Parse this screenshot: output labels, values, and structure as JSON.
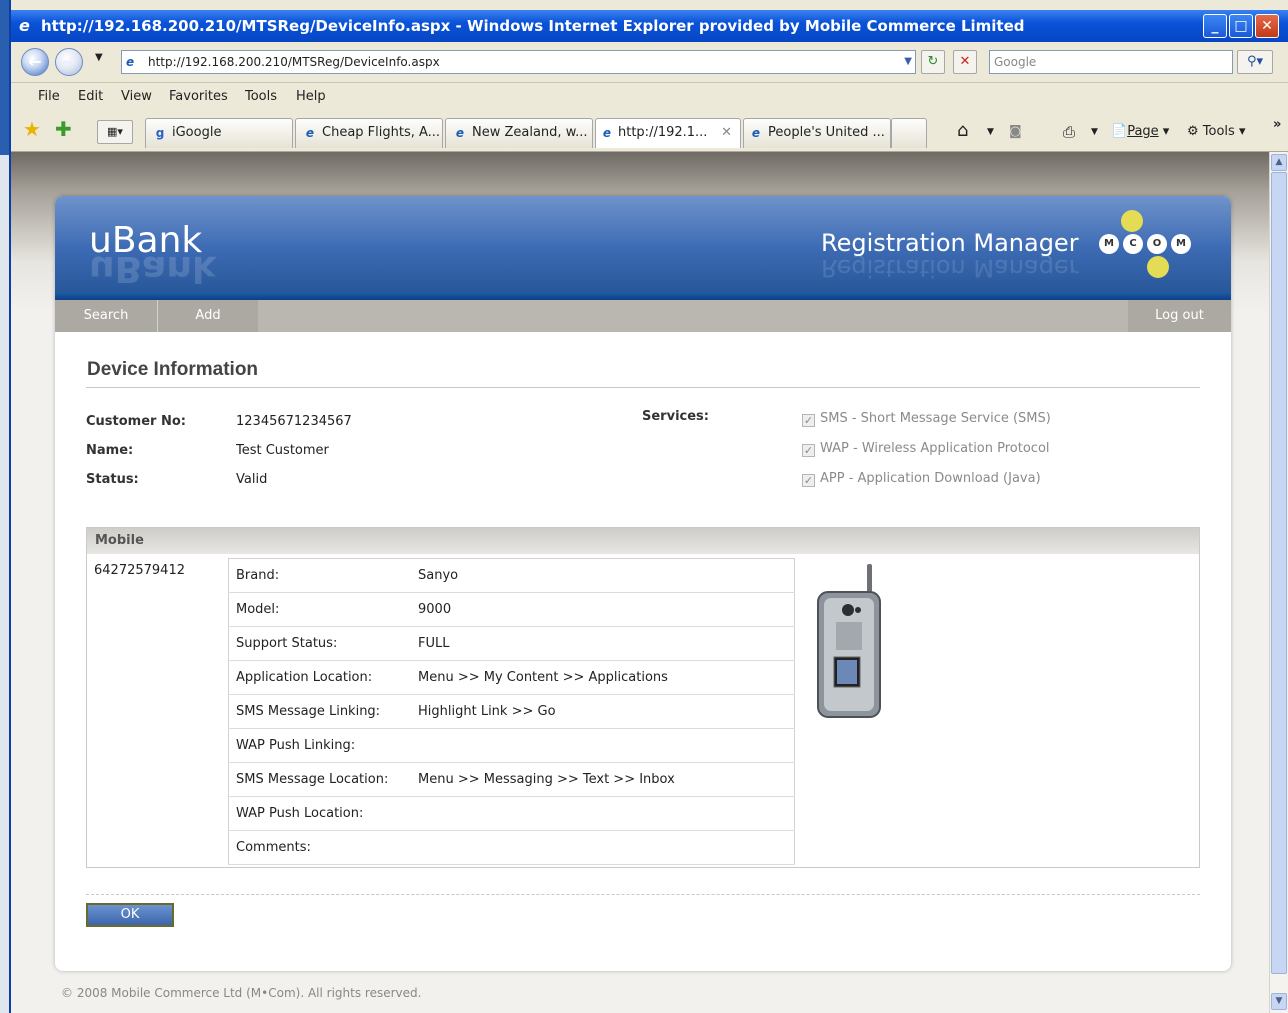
{
  "window": {
    "title": "http://192.168.200.210/MTSReg/DeviceInfo.aspx - Windows Internet Explorer provided by Mobile Commerce Limited",
    "url": "http://192.168.200.210/MTSReg/DeviceInfo.aspx",
    "search_placeholder": "Google"
  },
  "menu": [
    "File",
    "Edit",
    "View",
    "Favorites",
    "Tools",
    "Help"
  ],
  "tabs": [
    {
      "label": "iGoogle",
      "icon": "google-icon"
    },
    {
      "label": "Cheap Flights, A...",
      "icon": "ie-page-icon"
    },
    {
      "label": "New Zealand, w...",
      "icon": "ie-page-icon"
    },
    {
      "label": "http://192.1...",
      "icon": "ie-page-icon",
      "active": true
    },
    {
      "label": "People's United ...",
      "icon": "ie-page-icon"
    }
  ],
  "command_bar": {
    "page_label": "Page",
    "tools_label": "Tools"
  },
  "app": {
    "logo": "uBank",
    "product": "Registration Manager",
    "brand_letters": [
      "M",
      "C",
      "O",
      "M"
    ],
    "nav": {
      "search": "Search",
      "add": "Add",
      "logout": "Log out"
    }
  },
  "device_info": {
    "heading": "Device Information",
    "customer_no_label": "Customer No:",
    "customer_no": "12345671234567",
    "name_label": "Name:",
    "name": "Test Customer",
    "status_label": "Status:",
    "status": "Valid",
    "services_label": "Services:",
    "services": [
      {
        "label": "SMS - Short Message Service (SMS)",
        "checked": true
      },
      {
        "label": "WAP - Wireless Application Protocol",
        "checked": true
      },
      {
        "label": "APP - Application Download (Java)",
        "checked": true
      }
    ]
  },
  "mobile": {
    "heading": "Mobile",
    "number": "64272579412",
    "details": [
      {
        "label": "Brand:",
        "value": "Sanyo"
      },
      {
        "label": "Model:",
        "value": "9000"
      },
      {
        "label": "Support Status:",
        "value": "FULL"
      },
      {
        "label": "Application Location:",
        "value": "Menu >> My Content >> Applications"
      },
      {
        "label": "SMS Message Linking:",
        "value": "Highlight Link >> Go"
      },
      {
        "label": "WAP Push Linking:",
        "value": ""
      },
      {
        "label": "SMS Message Location:",
        "value": "Menu >> Messaging >> Text >> Inbox"
      },
      {
        "label": "WAP Push Location:",
        "value": ""
      },
      {
        "label": "Comments:",
        "value": ""
      }
    ]
  },
  "ok_label": "OK",
  "footer": "© 2008 Mobile Commerce Ltd (M•Com). All rights reserved."
}
